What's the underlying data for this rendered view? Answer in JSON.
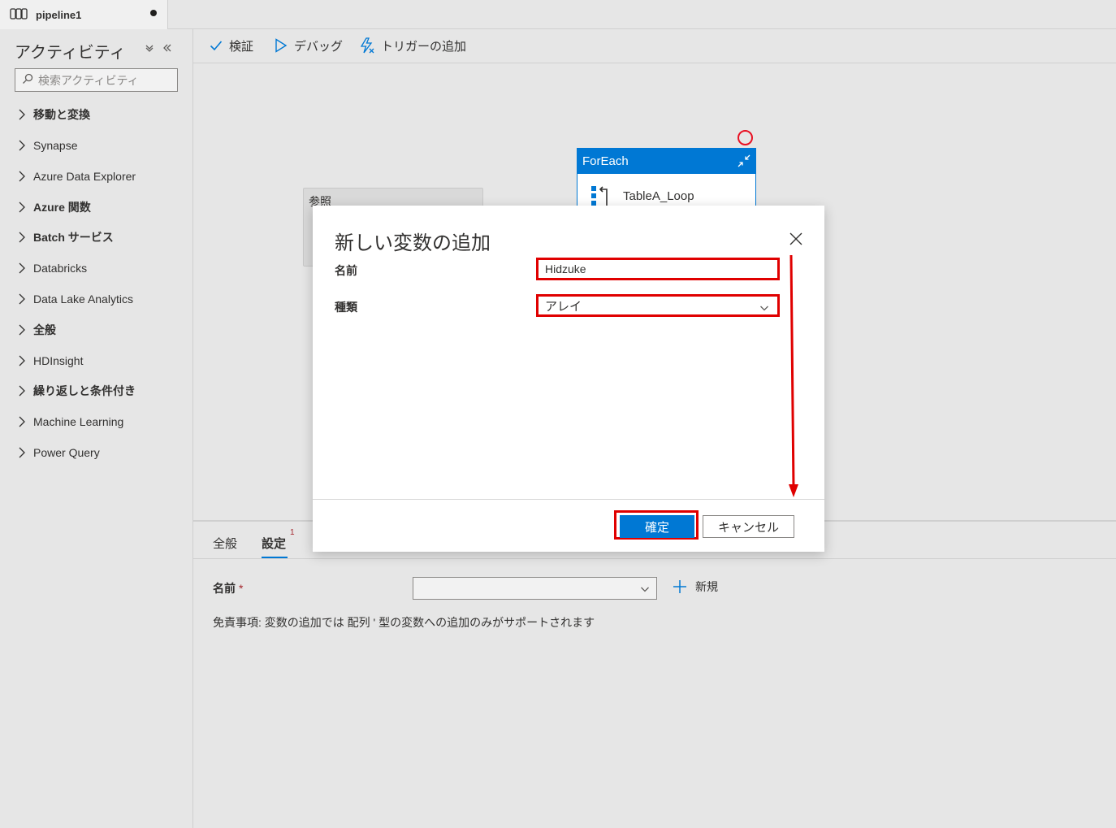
{
  "tab": {
    "name": "pipeline1"
  },
  "sidebar": {
    "title": "アクティビティ",
    "search_placeholder": "検索アクティビティ",
    "items": [
      {
        "label": "移動と変換"
      },
      {
        "label": "Synapse"
      },
      {
        "label": "Azure Data Explorer"
      },
      {
        "label": "Azure 関数"
      },
      {
        "label": "Batch サービス"
      },
      {
        "label": "Databricks"
      },
      {
        "label": "Data Lake Analytics"
      },
      {
        "label": "全般"
      },
      {
        "label": "HDInsight"
      },
      {
        "label": "繰り返しと条件付き"
      },
      {
        "label": "Machine Learning"
      },
      {
        "label": "Power Query"
      }
    ]
  },
  "toolbar": {
    "validate": "検証",
    "debug": "デバッグ",
    "add_trigger": "トリガーの追加"
  },
  "canvas": {
    "ref_node_title": "参照",
    "foreach_title": "ForEach",
    "foreach_activity": "TableA_Loop"
  },
  "bottom_panel": {
    "tabs": [
      {
        "label": "全般"
      },
      {
        "label": "設定",
        "badge": "1"
      }
    ],
    "name_label": "名前",
    "required_mark": "*",
    "new_label": "新規",
    "disclaimer": "免責事項: 変数の追加では 配列 ' 型の変数への追加のみがサポートされます"
  },
  "dialog": {
    "title": "新しい変数の追加",
    "name_label": "名前",
    "name_value": "Hidzuke",
    "type_label": "種類",
    "type_value": "アレイ",
    "ok_label": "確定",
    "cancel_label": "キャンセル"
  },
  "colors": {
    "accent": "#0078d4",
    "highlight": "#e00000"
  }
}
